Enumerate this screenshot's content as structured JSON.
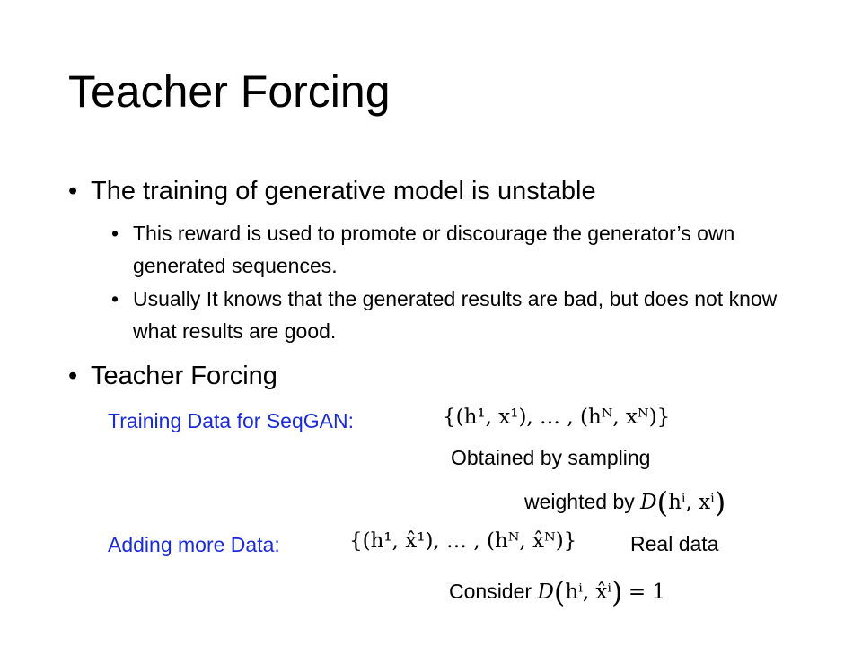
{
  "title": "Teacher Forcing",
  "bullets": {
    "b1": "The training of generative model is unstable",
    "b1_sub1": "This reward is used to promote or discourage the generator’s own generated sequences.",
    "b1_sub2": "Usually It knows that the generated results are bad, but does not know what results are good.",
    "b2": "Teacher Forcing"
  },
  "section_training": {
    "label": "Training Data for SeqGAN:",
    "formula": "{(h¹, x¹), … , (hᴺ, xᴺ)}",
    "note_line1": "Obtained by sampling",
    "note_line2_text": "weighted by",
    "note_line2_formula_prefix": "D",
    "note_line2_formula_args": "hⁱ, xⁱ"
  },
  "section_adding": {
    "label": "Adding more Data:",
    "formula": "{(h¹, x̂¹), … , (hᴺ, x̂ᴺ)}",
    "formula_note": "Real data",
    "consider_text": "Consider",
    "consider_formula_prefix": "D",
    "consider_formula_args": "hⁱ, x̂ⁱ",
    "consider_formula_rhs": "= 1"
  },
  "colors": {
    "label_blue": "#1a2bd6",
    "text": "#000000",
    "background": "#ffffff"
  }
}
